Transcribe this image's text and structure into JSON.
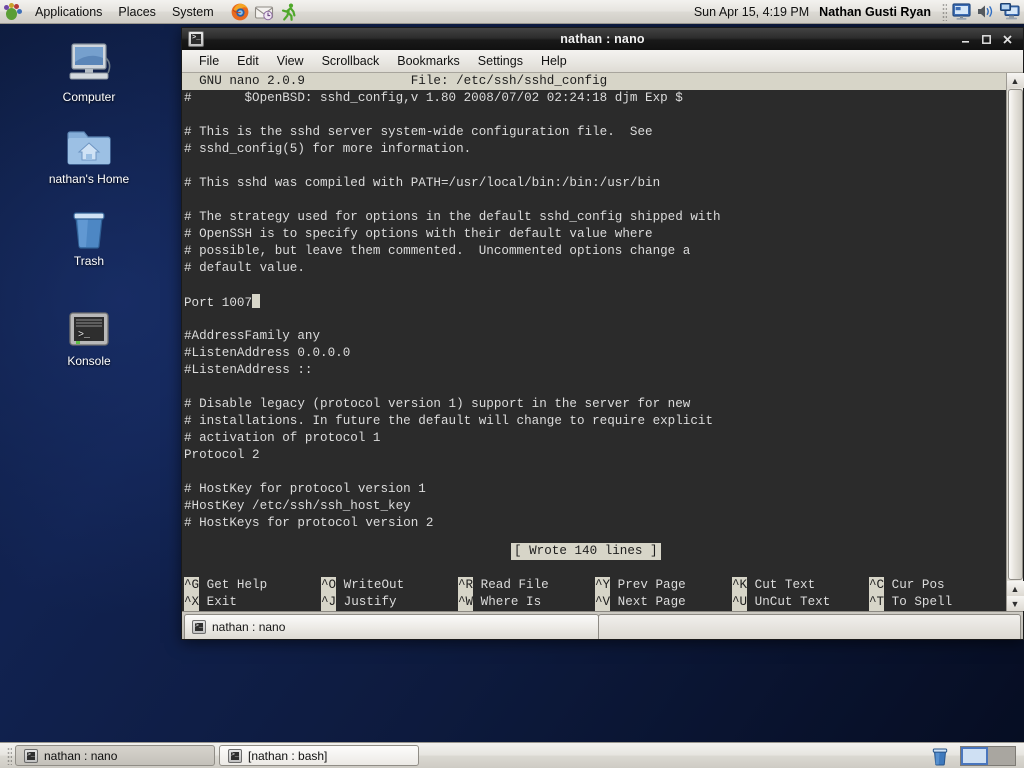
{
  "top_panel": {
    "logo_icon": "gnome-foot-icon",
    "menus": [
      "Applications",
      "Places",
      "System"
    ],
    "launchers": [
      {
        "name": "firefox-icon",
        "title": "Firefox"
      },
      {
        "name": "evolution-mail-icon",
        "title": "Evolution Mail"
      },
      {
        "name": "run-app-icon",
        "title": "Run Application"
      }
    ],
    "clock": "Sun Apr 15,  4:19 PM",
    "username": "Nathan Gusti Ryan",
    "tray": [
      {
        "name": "display-icon"
      },
      {
        "name": "volume-icon"
      },
      {
        "name": "network-icon"
      }
    ]
  },
  "desktop": {
    "icons": [
      {
        "label": "Computer",
        "icon": "computer-icon"
      },
      {
        "label": "nathan's Home",
        "icon": "home-folder-icon"
      },
      {
        "label": "Trash",
        "icon": "trash-icon"
      },
      {
        "label": "Konsole",
        "icon": "konsole-icon"
      }
    ]
  },
  "window": {
    "title": "nathan : nano",
    "icon": "konsole-icon",
    "buttons": {
      "minimize": "minimize-icon",
      "maximize": "maximize-icon",
      "close": "close-icon"
    },
    "menubar": [
      "File",
      "Edit",
      "View",
      "Scrollback",
      "Bookmarks",
      "Settings",
      "Help"
    ],
    "tabs": [
      {
        "label": "nathan : nano",
        "active": true
      }
    ]
  },
  "nano": {
    "header_left": "  GNU nano 2.0.9",
    "header_center": "File: /etc/ssh/sshd_config",
    "status_message": "[ Wrote 140 lines ]",
    "lines": [
      "#\t$OpenBSD: sshd_config,v 1.80 2008/07/02 02:24:18 djm Exp $",
      "",
      "# This is the sshd server system-wide configuration file.  See",
      "# sshd_config(5) for more information.",
      "",
      "# This sshd was compiled with PATH=/usr/local/bin:/bin:/usr/bin",
      "",
      "# The strategy used for options in the default sshd_config shipped with",
      "# OpenSSH is to specify options with their default value where",
      "# possible, but leave them commented.  Uncommented options change a",
      "# default value.",
      "",
      "Port 1007",
      "",
      "#AddressFamily any",
      "#ListenAddress 0.0.0.0",
      "#ListenAddress ::",
      "",
      "# Disable legacy (protocol version 1) support in the server for new",
      "# installations. In future the default will change to require explicit",
      "# activation of protocol 1",
      "Protocol 2",
      "",
      "# HostKey for protocol version 1",
      "#HostKey /etc/ssh/ssh_host_key",
      "# HostKeys for protocol version 2"
    ],
    "cursor_line_index": 12,
    "shortcuts_row1": [
      {
        "key": "^G",
        "label": "Get Help"
      },
      {
        "key": "^O",
        "label": "WriteOut"
      },
      {
        "key": "^R",
        "label": "Read File"
      },
      {
        "key": "^Y",
        "label": "Prev Page"
      },
      {
        "key": "^K",
        "label": "Cut Text"
      },
      {
        "key": "^C",
        "label": "Cur Pos"
      }
    ],
    "shortcuts_row2": [
      {
        "key": "^X",
        "label": "Exit"
      },
      {
        "key": "^J",
        "label": "Justify"
      },
      {
        "key": "^W",
        "label": "Where Is"
      },
      {
        "key": "^V",
        "label": "Next Page"
      },
      {
        "key": "^U",
        "label": "UnCut Text"
      },
      {
        "key": "^T",
        "label": "To Spell"
      }
    ]
  },
  "bottom_panel": {
    "tasks": [
      {
        "label": "nathan : nano",
        "active": true
      },
      {
        "label": "[nathan : bash]",
        "active": false
      }
    ],
    "trash_icon": "trash-icon",
    "workspaces": [
      {
        "active": true
      },
      {
        "active": false
      }
    ]
  },
  "colors": {
    "terminal_bg": "#2b2b2b",
    "terminal_fg": "#dcdcdc",
    "nano_bar_bg": "#d7d5c8",
    "nano_bar_fg": "#1d1d1d",
    "desktop_base": "#0d1a3d",
    "titlebar_bg": "#1c1c1c",
    "panel_bg": "#e6e4df"
  }
}
